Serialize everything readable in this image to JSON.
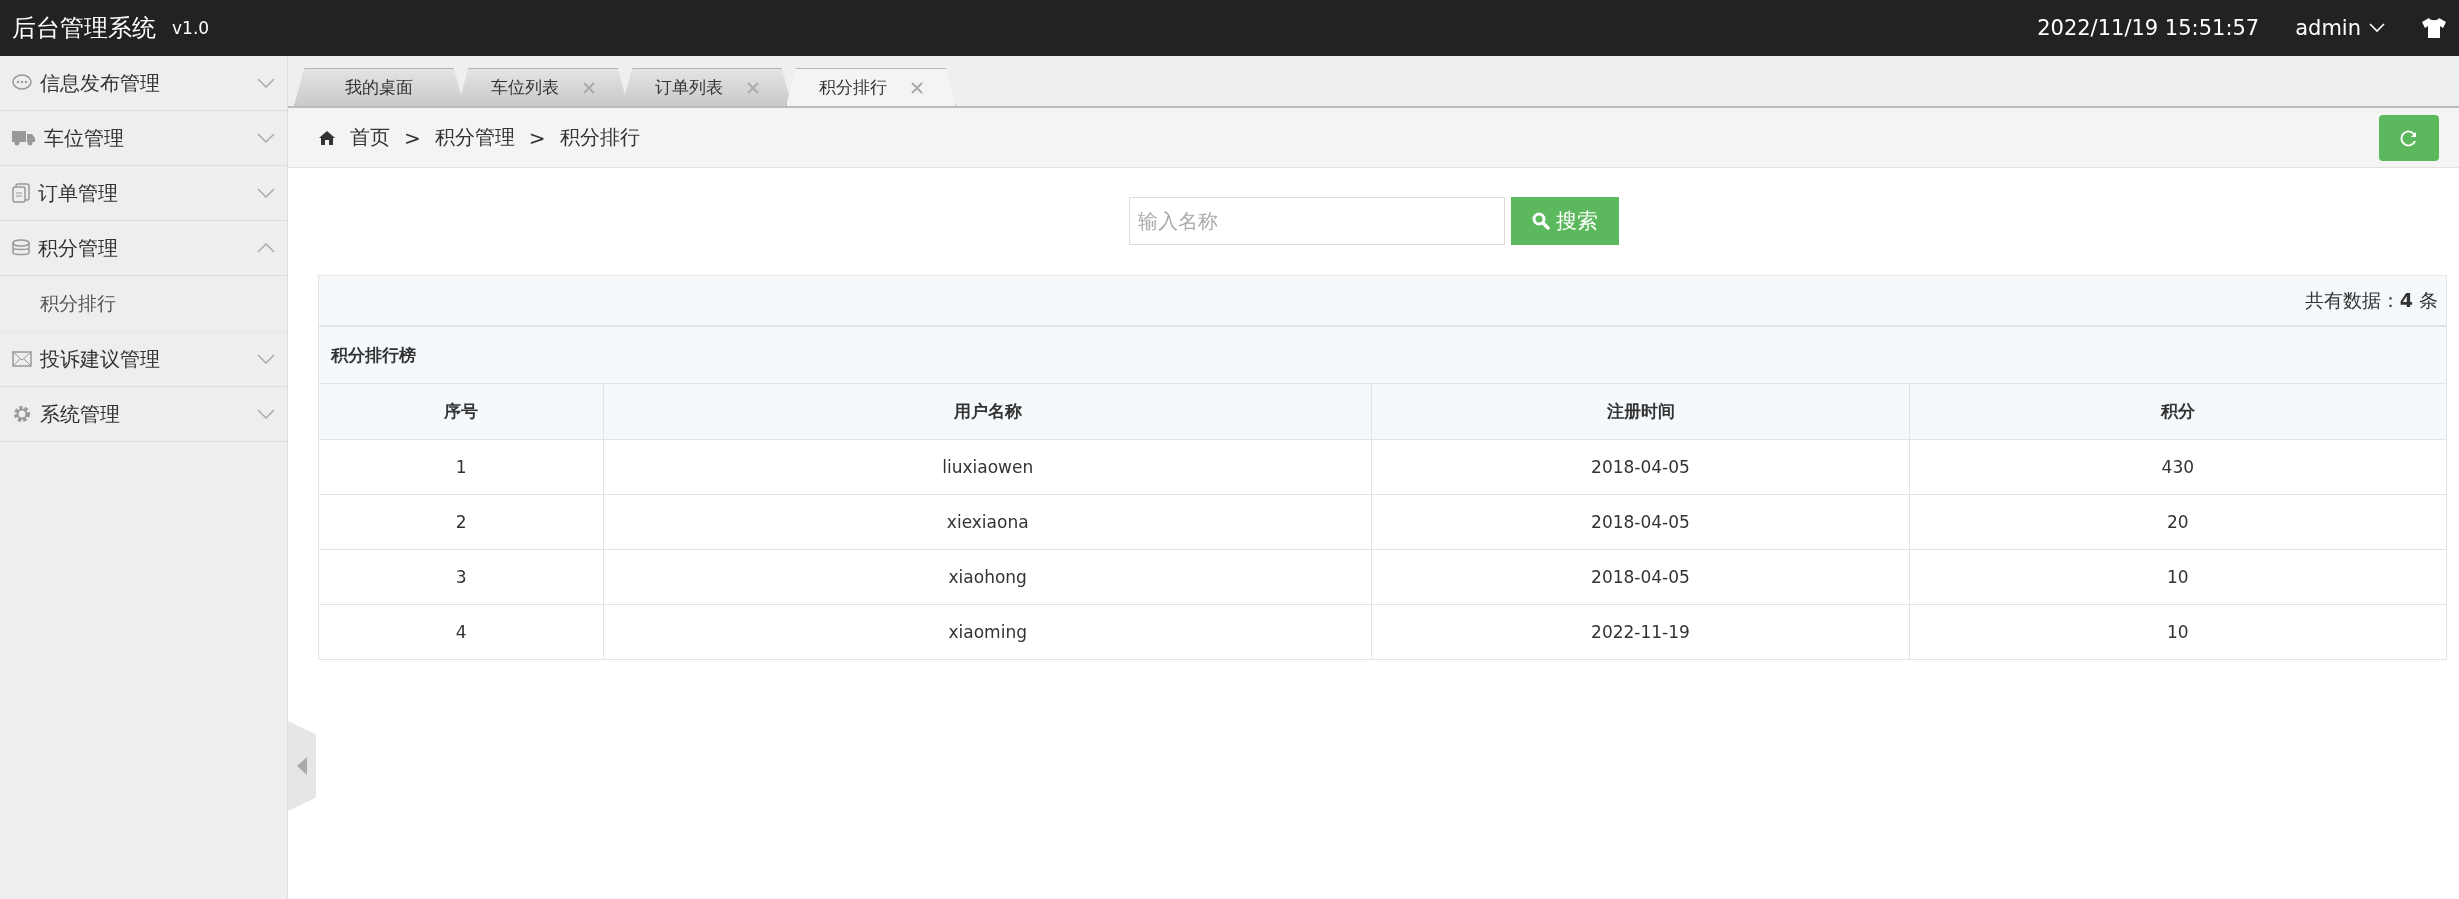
{
  "header": {
    "title": "后台管理系统",
    "version": "v1.0",
    "datetime": "2022/11/19 15:51:57",
    "user": "admin"
  },
  "sidebar": {
    "items": [
      {
        "label": "信息发布管理",
        "expanded": false
      },
      {
        "label": "车位管理",
        "expanded": false
      },
      {
        "label": "订单管理",
        "expanded": false
      },
      {
        "label": "积分管理",
        "expanded": true,
        "children": [
          {
            "label": "积分排行"
          }
        ]
      },
      {
        "label": "投诉建议管理",
        "expanded": false
      },
      {
        "label": "系统管理",
        "expanded": false
      }
    ]
  },
  "tabs": [
    {
      "label": "我的桌面",
      "closable": false,
      "selected": false
    },
    {
      "label": "车位列表",
      "closable": true,
      "selected": false
    },
    {
      "label": "订单列表",
      "closable": true,
      "selected": false
    },
    {
      "label": "积分排行",
      "closable": true,
      "selected": true
    }
  ],
  "breadcrumb": [
    "首页",
    "积分管理",
    "积分排行"
  ],
  "breadcrumb_separator": ">",
  "search": {
    "placeholder": "输入名称",
    "button": "搜索"
  },
  "summary": "共有数据：**4** 条",
  "table": {
    "title": "积分排行榜",
    "columns": [
      "序号",
      "用户名称",
      "注册时间",
      "积分"
    ],
    "rows": [
      [
        "1",
        "liuxiaowen",
        "2018-04-05",
        "430"
      ],
      [
        "2",
        "xiexiaona",
        "2018-04-05",
        "20"
      ],
      [
        "3",
        "xiaohong",
        "2018-04-05",
        "10"
      ],
      [
        "4",
        "xiaoming",
        "2022-11-19",
        "10"
      ]
    ]
  }
}
